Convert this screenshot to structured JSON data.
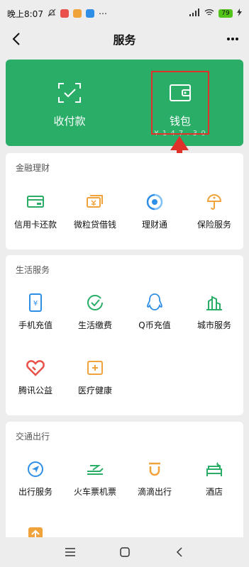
{
  "status_bar": {
    "time": "晚上8:07",
    "dots": "⋯",
    "battery": "79"
  },
  "header": {
    "title": "服务"
  },
  "hero": {
    "pay": {
      "label": "收付款",
      "icon": "scan-pay-icon"
    },
    "wallet": {
      "label": "钱包",
      "sub": "¥ 1 4 7 . 3 0",
      "icon": "wallet-icon"
    }
  },
  "sections": {
    "finance": {
      "title": "金融理财",
      "items": [
        {
          "label": "信用卡还款",
          "icon": "credit-card-icon",
          "color": "#2aae67"
        },
        {
          "label": "微粒贷借钱",
          "icon": "micro-loan-icon",
          "color": "#f0a33a"
        },
        {
          "label": "理财通",
          "icon": "wealth-icon",
          "color": "#2f8fe6"
        },
        {
          "label": "保险服务",
          "icon": "insurance-icon",
          "color": "#f0a33a"
        }
      ]
    },
    "life": {
      "title": "生活服务",
      "items": [
        {
          "label": "手机充值",
          "icon": "phone-topup-icon",
          "color": "#2f8fe6"
        },
        {
          "label": "生活缴费",
          "icon": "utility-bill-icon",
          "color": "#2aae67"
        },
        {
          "label": "Q币充值",
          "icon": "qq-coin-icon",
          "color": "#2f8fe6"
        },
        {
          "label": "城市服务",
          "icon": "city-service-icon",
          "color": "#2aae67"
        },
        {
          "label": "腾讯公益",
          "icon": "charity-heart-icon",
          "color": "#e8524a"
        },
        {
          "label": "医疗健康",
          "icon": "medical-icon",
          "color": "#f0a33a"
        }
      ]
    },
    "travel": {
      "title": "交通出行",
      "items": [
        {
          "label": "出行服务",
          "icon": "navigation-icon",
          "color": "#2f8fe6"
        },
        {
          "label": "火车票机票",
          "icon": "train-plane-icon",
          "color": "#2aae67"
        },
        {
          "label": "滴滴出行",
          "icon": "didi-icon",
          "color": "#f0a33a"
        },
        {
          "label": "酒店",
          "icon": "hotel-bed-icon",
          "color": "#2aae67"
        },
        {
          "label": "",
          "icon": "more-travel-icon",
          "color": "#f0a33a"
        }
      ]
    }
  }
}
